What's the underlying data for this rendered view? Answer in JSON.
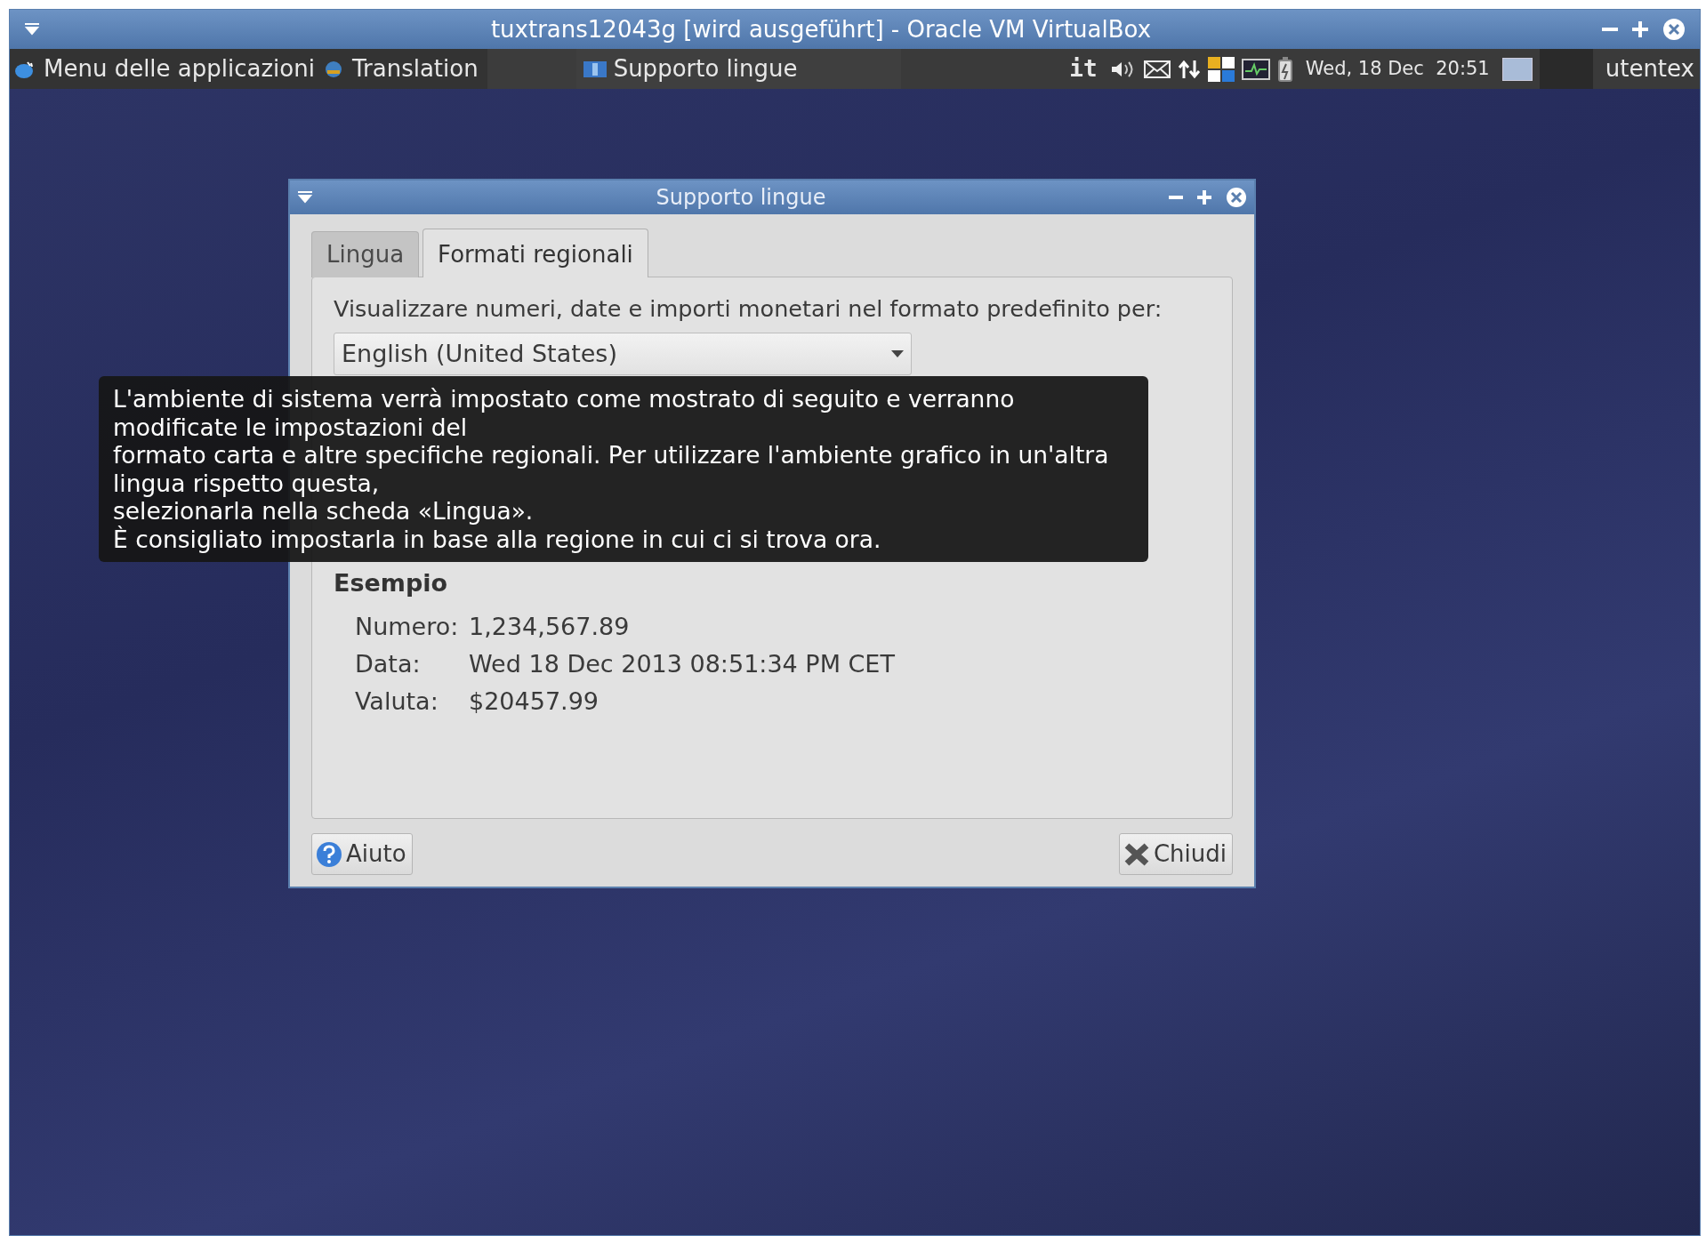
{
  "window": {
    "title": "tuxtrans12043g [wird ausgeführt] - Oracle VM VirtualBox"
  },
  "panel": {
    "app_menu": "Menu delle applicazioni",
    "launcher": "Translation",
    "tasks": [
      {
        "label": "Supporto lingue",
        "selected": true
      }
    ],
    "keyboard_layout": "it",
    "clock": "Wed, 18 Dec  20:51",
    "user": "utentex"
  },
  "dialog": {
    "title": "Supporto lingue",
    "tabs": [
      {
        "label": "Lingua",
        "selected": false
      },
      {
        "label": "Formati regionali",
        "selected": true
      }
    ],
    "description": "Visualizzare numeri, date e importi monetari nel formato predefinito per:",
    "format_select": {
      "value": "English (United States)"
    },
    "example": {
      "heading": "Esempio",
      "rows": [
        {
          "label": "Numero:",
          "value": "1,234,567.89"
        },
        {
          "label": "Data:",
          "value": "Wed 18 Dec 2013 08:51:34 PM CET"
        },
        {
          "label": "Valuta:",
          "value": "$20457.99"
        }
      ]
    },
    "buttons": [
      {
        "label": "Aiuto",
        "kind": "help"
      },
      {
        "label": "Chiudi",
        "kind": "close"
      }
    ]
  },
  "tooltip": {
    "lines": [
      "L'ambiente di sistema verrà impostato come mostrato di seguito e verranno",
      "modificate le impostazioni del",
      "formato carta e altre specifiche regionali. Per utilizzare l'ambiente grafico in un'altra",
      "lingua rispetto questa,",
      "selezionarla nella scheda «Lingua».",
      "È consigliato impostarla in base alla regione in cui ci si trova ora."
    ]
  }
}
